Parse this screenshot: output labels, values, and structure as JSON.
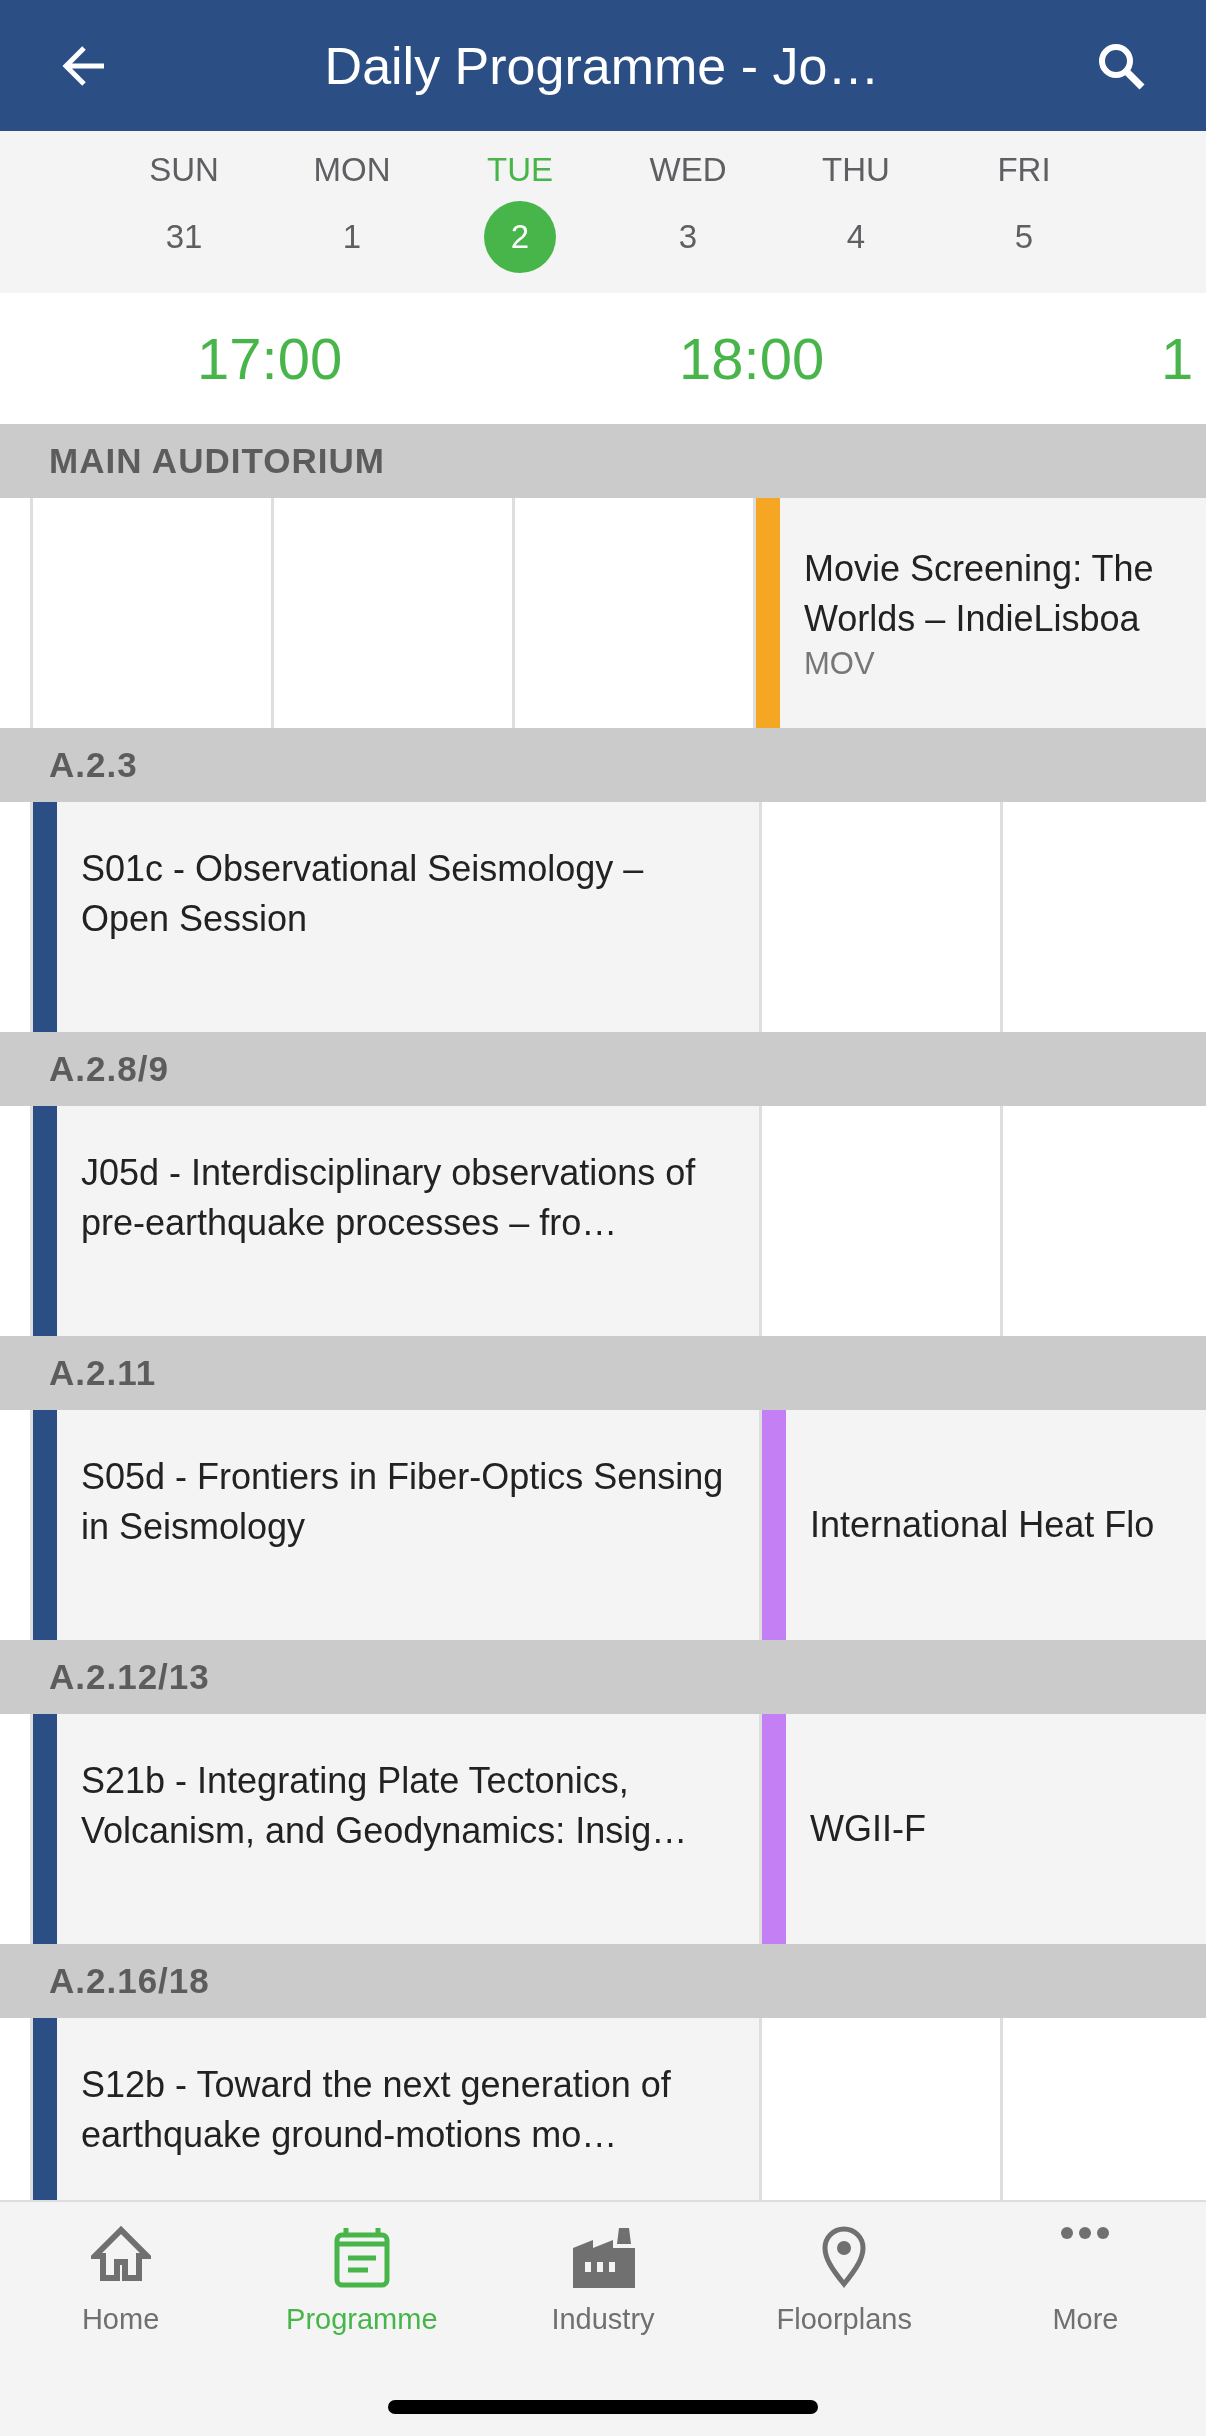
{
  "header": {
    "title": "Daily Programme - Jo…"
  },
  "days": [
    {
      "day": "SUN",
      "date": "31",
      "selected": false
    },
    {
      "day": "MON",
      "date": "1",
      "selected": false
    },
    {
      "day": "TUE",
      "date": "2",
      "selected": true
    },
    {
      "day": "WED",
      "date": "3",
      "selected": false
    },
    {
      "day": "THU",
      "date": "4",
      "selected": false
    },
    {
      "day": "FRI",
      "date": "5",
      "selected": false
    }
  ],
  "times": [
    "17:00",
    "18:00",
    "1"
  ],
  "rooms": [
    {
      "name": "MAIN AUDITORIUM",
      "sessions": [
        {
          "kind": "late",
          "lines": [
            "Movie Screening: The",
            "Worlds – IndieLisboa"
          ],
          "code": "MOV",
          "color": "#f5a623"
        }
      ]
    },
    {
      "name": "A.2.3",
      "sessions": [
        {
          "kind": "early",
          "title": "S01c - Observational Seismology – Open Session",
          "color": "#2b4f85"
        }
      ]
    },
    {
      "name": "A.2.8/9",
      "sessions": [
        {
          "kind": "early",
          "title": "J05d - Interdisciplinary observations of pre-earthquake processes – fro…",
          "color": "#2b4f85"
        }
      ]
    },
    {
      "name": "A.2.11",
      "sessions": [
        {
          "kind": "early",
          "title": "S05d - Frontiers in Fiber-Optics Sensing in Seismology",
          "color": "#2b4f85"
        },
        {
          "kind": "late",
          "lines": [
            "International Heat Flo"
          ],
          "color": "#c47ff5"
        }
      ]
    },
    {
      "name": "A.2.12/13",
      "sessions": [
        {
          "kind": "early",
          "title": "S21b - Integrating Plate Tectonics, Volcanism, and Geodynamics: Insig…",
          "color": "#2b4f85"
        },
        {
          "kind": "late",
          "lines": [
            "WGII-F"
          ],
          "color": "#c47ff5"
        }
      ]
    },
    {
      "name": "A.2.16/18",
      "sessions": [
        {
          "kind": "early",
          "title": "S12b - Toward the next generation of earthquake ground-motions mo…",
          "color": "#2b4f85"
        }
      ]
    }
  ],
  "nav": [
    {
      "label": "Home",
      "selected": false
    },
    {
      "label": "Programme",
      "selected": true
    },
    {
      "label": "Industry",
      "selected": false
    },
    {
      "label": "Floorplans",
      "selected": false
    },
    {
      "label": "More",
      "selected": false
    }
  ]
}
